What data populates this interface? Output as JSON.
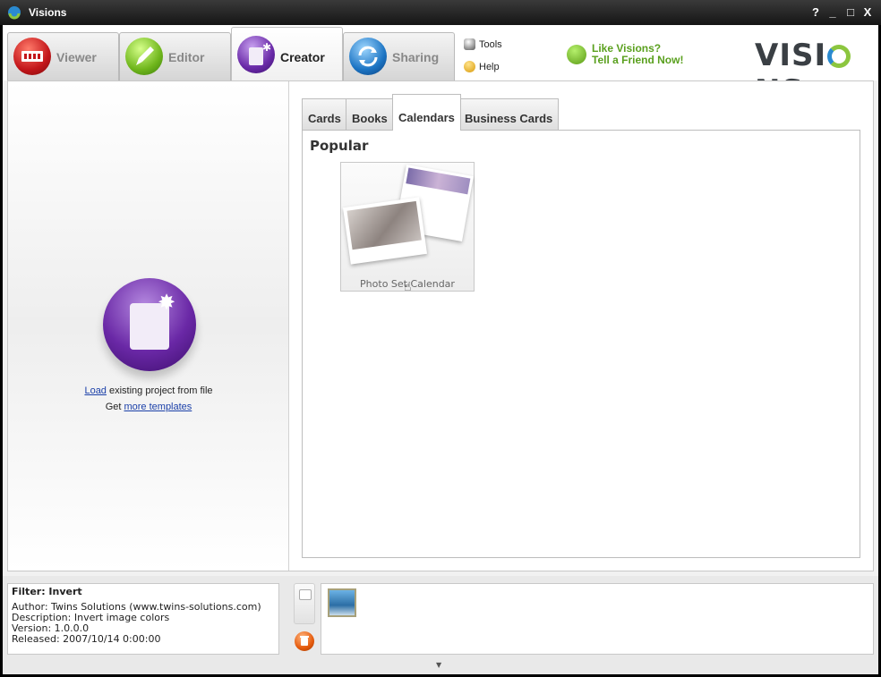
{
  "window": {
    "title": "Visions",
    "help_label": "?",
    "minimize_label": "_",
    "maximize_label": "□",
    "close_label": "X"
  },
  "main_tabs": [
    {
      "label": "Viewer"
    },
    {
      "label": "Editor"
    },
    {
      "label": "Creator",
      "active": true
    },
    {
      "label": "Sharing"
    }
  ],
  "toolbar": {
    "tools_label": "Tools",
    "help_label": "Help"
  },
  "promo": {
    "line1": "Like Visions?",
    "line2": "Tell a Friend Now!"
  },
  "logo": {
    "prefix": "VISI",
    "suffix": "NS"
  },
  "left_panel": {
    "load_link": "Load",
    "load_text": " existing project from file",
    "get_text": "Get ",
    "templates_link": "more templates"
  },
  "sub_tabs": [
    {
      "label": "Cards"
    },
    {
      "label": "Books"
    },
    {
      "label": "Calendars",
      "active": true
    },
    {
      "label": "Business Cards"
    }
  ],
  "gallery": {
    "section_title": "Popular",
    "items": [
      {
        "label": "Photo Set Calendar"
      }
    ]
  },
  "info": {
    "title": "Filter: Invert",
    "author": "Author: Twins Solutions (www.twins-solutions.com)",
    "description": "Description: Invert image colors",
    "version": "Version: 1.0.0.0",
    "released": "Released: 2007/10/14 0:00:00"
  },
  "colors": {
    "accent_green": "#5aa01e",
    "link_blue": "#1a3fa8"
  }
}
